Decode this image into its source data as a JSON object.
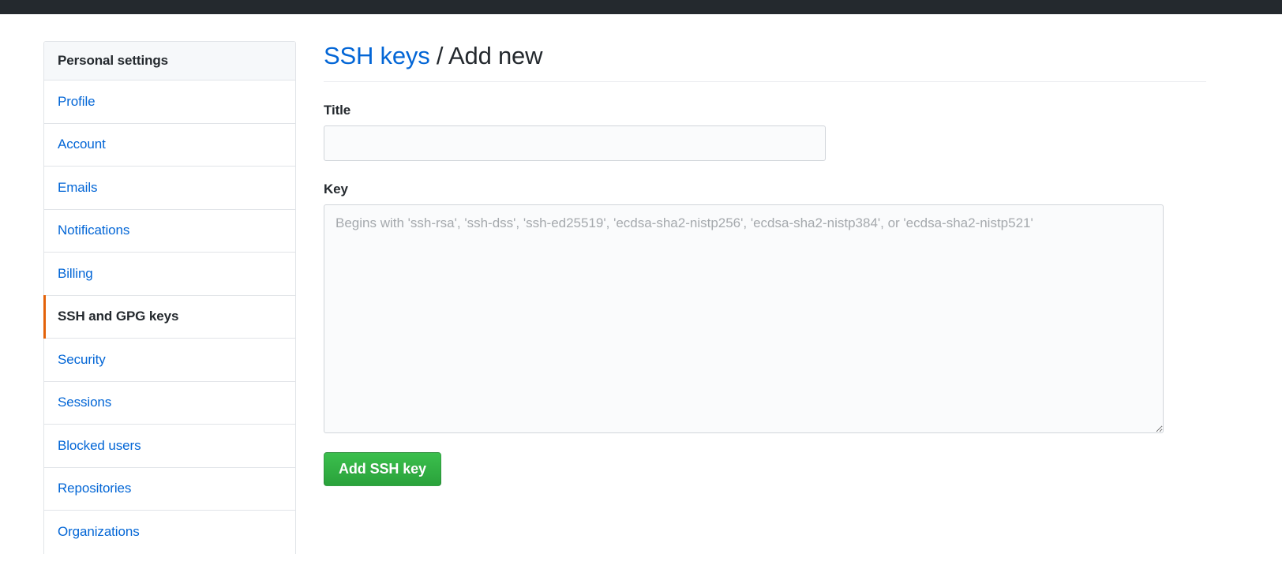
{
  "topbar": {
    "present": true,
    "background": "#24292e"
  },
  "sidebar": {
    "header": "Personal settings",
    "accent_color": "#e36209",
    "items": [
      {
        "label": "Profile",
        "selected": false
      },
      {
        "label": "Account",
        "selected": false
      },
      {
        "label": "Emails",
        "selected": false
      },
      {
        "label": "Notifications",
        "selected": false
      },
      {
        "label": "Billing",
        "selected": false
      },
      {
        "label": "SSH and GPG keys",
        "selected": true
      },
      {
        "label": "Security",
        "selected": false
      },
      {
        "label": "Sessions",
        "selected": false
      },
      {
        "label": "Blocked users",
        "selected": false
      },
      {
        "label": "Repositories",
        "selected": false
      },
      {
        "label": "Organizations",
        "selected": false
      }
    ]
  },
  "main": {
    "heading": {
      "link_text": "SSH keys",
      "separator": "/",
      "current": "Add new",
      "link_color": "#0366d6"
    },
    "form": {
      "title_label": "Title",
      "title_value": "",
      "title_placeholder": "",
      "key_label": "Key",
      "key_value": "",
      "key_placeholder": "Begins with 'ssh-rsa', 'ssh-dss', 'ssh-ed25519', 'ecdsa-sha2-nistp256', 'ecdsa-sha2-nistp384', or 'ecdsa-sha2-nistp521'",
      "submit_label": "Add SSH key",
      "submit_color": "#2ea44f"
    }
  }
}
